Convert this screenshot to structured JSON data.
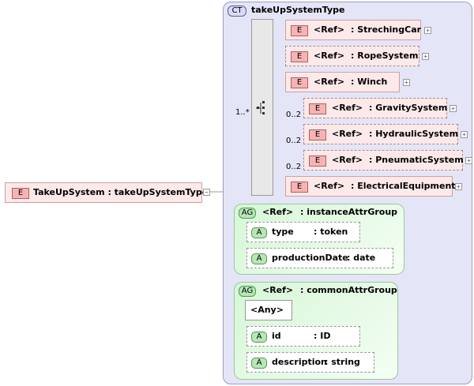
{
  "root": {
    "badge": "E",
    "label": "TakeUpSystem : takeUpSystemType"
  },
  "complex_type": {
    "badge": "CT",
    "name": "takeUpSystemType",
    "sequence_multiplicity": "1..*"
  },
  "elements": [
    {
      "badge": "E",
      "ref": "<Ref>",
      "name": ": StrechingCar",
      "multiplicity": ""
    },
    {
      "badge": "E",
      "ref": "<Ref>",
      "name": ": RopeSystem",
      "multiplicity": ""
    },
    {
      "badge": "E",
      "ref": "<Ref>",
      "name": ": Winch",
      "multiplicity": ""
    },
    {
      "badge": "E",
      "ref": "<Ref>",
      "name": ": GravitySystem",
      "multiplicity": "0..2"
    },
    {
      "badge": "E",
      "ref": "<Ref>",
      "name": ": HydraulicSystem",
      "multiplicity": "0..2"
    },
    {
      "badge": "E",
      "ref": "<Ref>",
      "name": ": PneumaticSystem",
      "multiplicity": "0..2"
    },
    {
      "badge": "E",
      "ref": "<Ref>",
      "name": ": ElectricalEquipment",
      "multiplicity": ""
    }
  ],
  "attribute_groups": [
    {
      "badge": "AG",
      "ref": "<Ref>",
      "name": ": instanceAttrGroup",
      "attributes": [
        {
          "badge": "A",
          "name": "type",
          "type": ": token"
        },
        {
          "badge": "A",
          "name": "productionDate",
          "type": ": date"
        }
      ]
    },
    {
      "badge": "AG",
      "ref": "<Ref>",
      "name": ": commonAttrGroup",
      "any": "<Any>",
      "attributes": [
        {
          "badge": "A",
          "name": "id",
          "type": ": ID"
        },
        {
          "badge": "A",
          "name": "description",
          "type": ": string"
        }
      ]
    }
  ],
  "icons": {
    "expand": "plus-icon",
    "collapse": "minus-icon",
    "sequence": "sequence-icon"
  },
  "colors": {
    "complex_type_bg": "#e4e6f7",
    "element_bg": "#fde9e9",
    "element_badge": "#f6b3b3",
    "attribute_badge": "#b7e6b7",
    "group_bg": "#d6f7d6"
  }
}
